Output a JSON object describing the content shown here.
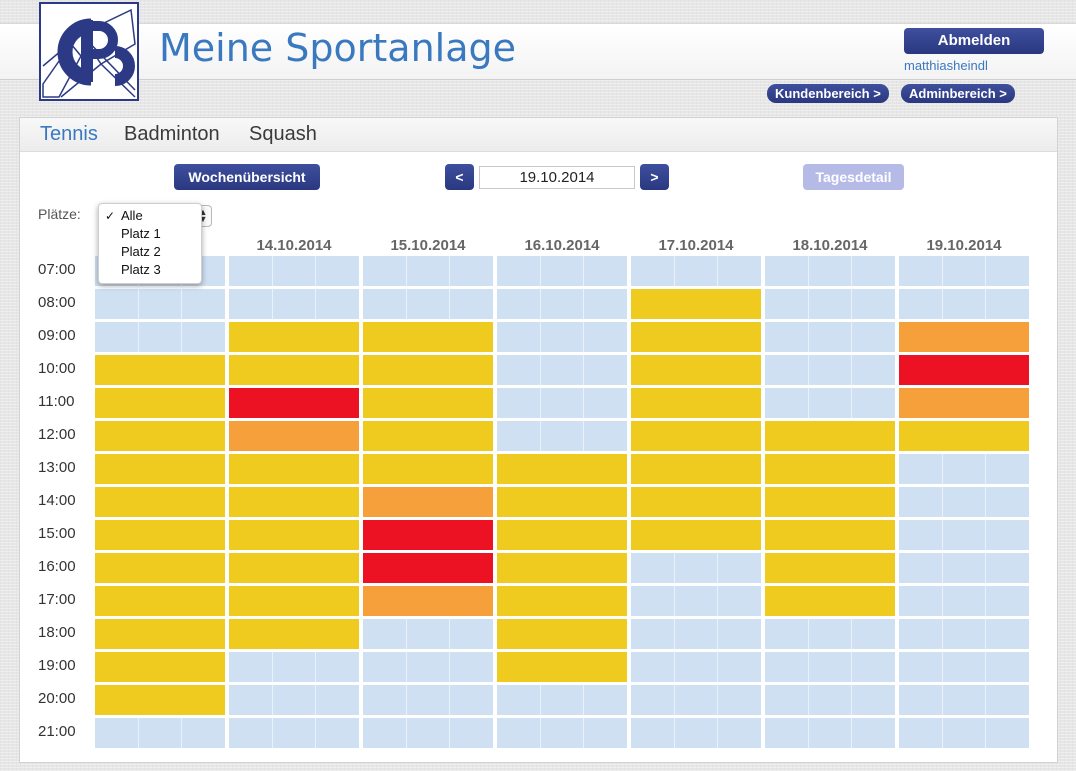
{
  "header": {
    "title": "Meine Sportanlage",
    "logout_label": "Abmelden",
    "username": "matthiasheindl",
    "customer_area_label": "Kundenbereich >",
    "admin_area_label": "Adminbereich >"
  },
  "sports": {
    "tabs": [
      {
        "label": "Tennis",
        "active": true
      },
      {
        "label": "Badminton",
        "active": false
      },
      {
        "label": "Squash",
        "active": false
      }
    ]
  },
  "toolbar": {
    "week_overview_label": "Wochenübersicht",
    "prev_label": "<",
    "next_label": ">",
    "date_value": "19.10.2014",
    "day_detail_label": "Tagesdetail"
  },
  "filter": {
    "label": "Plätze:",
    "selected": "Alle",
    "check": "✓",
    "options": [
      "Alle",
      "Platz 1",
      "Platz 2",
      "Platz 3"
    ]
  },
  "schedule": {
    "days": [
      "",
      "14.10.2014",
      "15.10.2014",
      "16.10.2014",
      "17.10.2014",
      "18.10.2014",
      "19.10.2014"
    ],
    "times": [
      "07:00",
      "08:00",
      "09:00",
      "10:00",
      "11:00",
      "12:00",
      "13:00",
      "14:00",
      "15:00",
      "16:00",
      "17:00",
      "18:00",
      "19:00",
      "20:00",
      "21:00"
    ],
    "colors": {
      "free": "#cfe0f3",
      "booked": "#eecb1e",
      "high": "#f6a03c",
      "full": "#ec1123"
    },
    "occupancy": [
      [
        "free",
        "free",
        "free",
        "free",
        "free",
        "free",
        "free"
      ],
      [
        "free",
        "free",
        "free",
        "free",
        "booked",
        "free",
        "free"
      ],
      [
        "free",
        "booked",
        "booked",
        "free",
        "booked",
        "free",
        "high"
      ],
      [
        "booked",
        "booked",
        "booked",
        "free",
        "booked",
        "free",
        "full"
      ],
      [
        "booked",
        "full",
        "booked",
        "free",
        "booked",
        "free",
        "high"
      ],
      [
        "booked",
        "high",
        "booked",
        "free",
        "booked",
        "booked",
        "booked"
      ],
      [
        "booked",
        "booked",
        "booked",
        "booked",
        "booked",
        "booked",
        "free"
      ],
      [
        "booked",
        "booked",
        "high",
        "booked",
        "booked",
        "booked",
        "free"
      ],
      [
        "booked",
        "booked",
        "full",
        "booked",
        "booked",
        "booked",
        "free"
      ],
      [
        "booked",
        "booked",
        "full",
        "booked",
        "free",
        "booked",
        "free"
      ],
      [
        "booked",
        "booked",
        "high",
        "booked",
        "free",
        "booked",
        "free"
      ],
      [
        "booked",
        "booked",
        "free",
        "booked",
        "free",
        "free",
        "free"
      ],
      [
        "booked",
        "free",
        "free",
        "booked",
        "free",
        "free",
        "free"
      ],
      [
        "booked",
        "free",
        "free",
        "free",
        "free",
        "free",
        "free"
      ],
      [
        "free",
        "free",
        "free",
        "free",
        "free",
        "free",
        "free"
      ]
    ]
  }
}
